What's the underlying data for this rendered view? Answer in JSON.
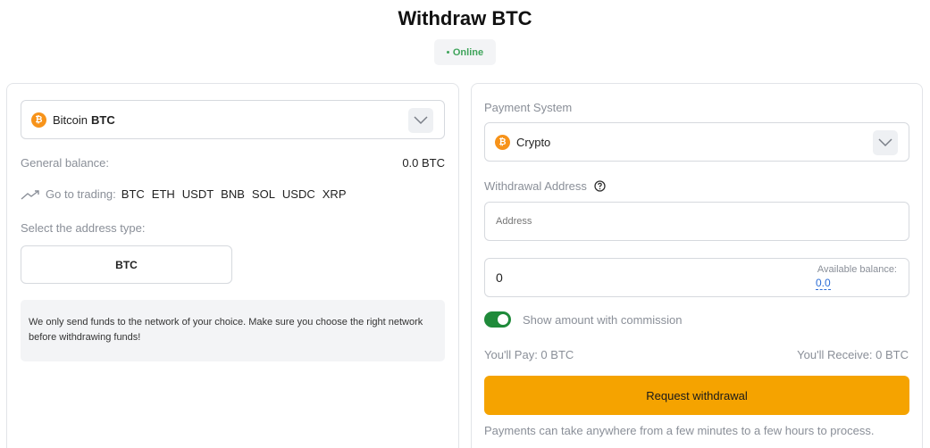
{
  "header": {
    "title": "Withdraw BTC",
    "status": "Online",
    "status_color": "#3fa45b"
  },
  "left": {
    "currency": {
      "name": "Bitcoin",
      "ticker": "BTC",
      "icon": "bitcoin-icon",
      "icon_glyph": "₿"
    },
    "balance": {
      "label": "General balance:",
      "value": "0.0 BTC"
    },
    "trading": {
      "label": "Go to trading:",
      "icon": "trend-up-icon",
      "links": [
        "BTC",
        "ETH",
        "USDT",
        "BNB",
        "SOL",
        "USDC",
        "XRP"
      ]
    },
    "address_type": {
      "label": "Select the address type:",
      "option": "BTC"
    },
    "notice": "We only send funds to the network of your choice. Make sure you choose the right network before withdrawing funds!"
  },
  "right": {
    "payment_system": {
      "label": "Payment System",
      "value": "Crypto",
      "icon": "bitcoin-icon",
      "icon_glyph": "₿"
    },
    "withdrawal_address": {
      "label": "Withdrawal Address",
      "help_icon": "help-circle-icon",
      "placeholder": "Address"
    },
    "amount": {
      "value": "0",
      "available_label": "Available balance:",
      "available_value": "0.0"
    },
    "commission_toggle": {
      "label": "Show amount with commission",
      "on": true
    },
    "pay": "You'll Pay: 0 BTC",
    "receive": "You'll Receive: 0 BTC",
    "cta": "Request withdrawal",
    "footnote": "Payments can take anywhere from a few minutes to a few hours to process."
  },
  "colors": {
    "accent": "#f5a300",
    "bitcoin": "#f7931a",
    "toggle_on": "#1f8a3a",
    "link": "#2b6cd6"
  }
}
